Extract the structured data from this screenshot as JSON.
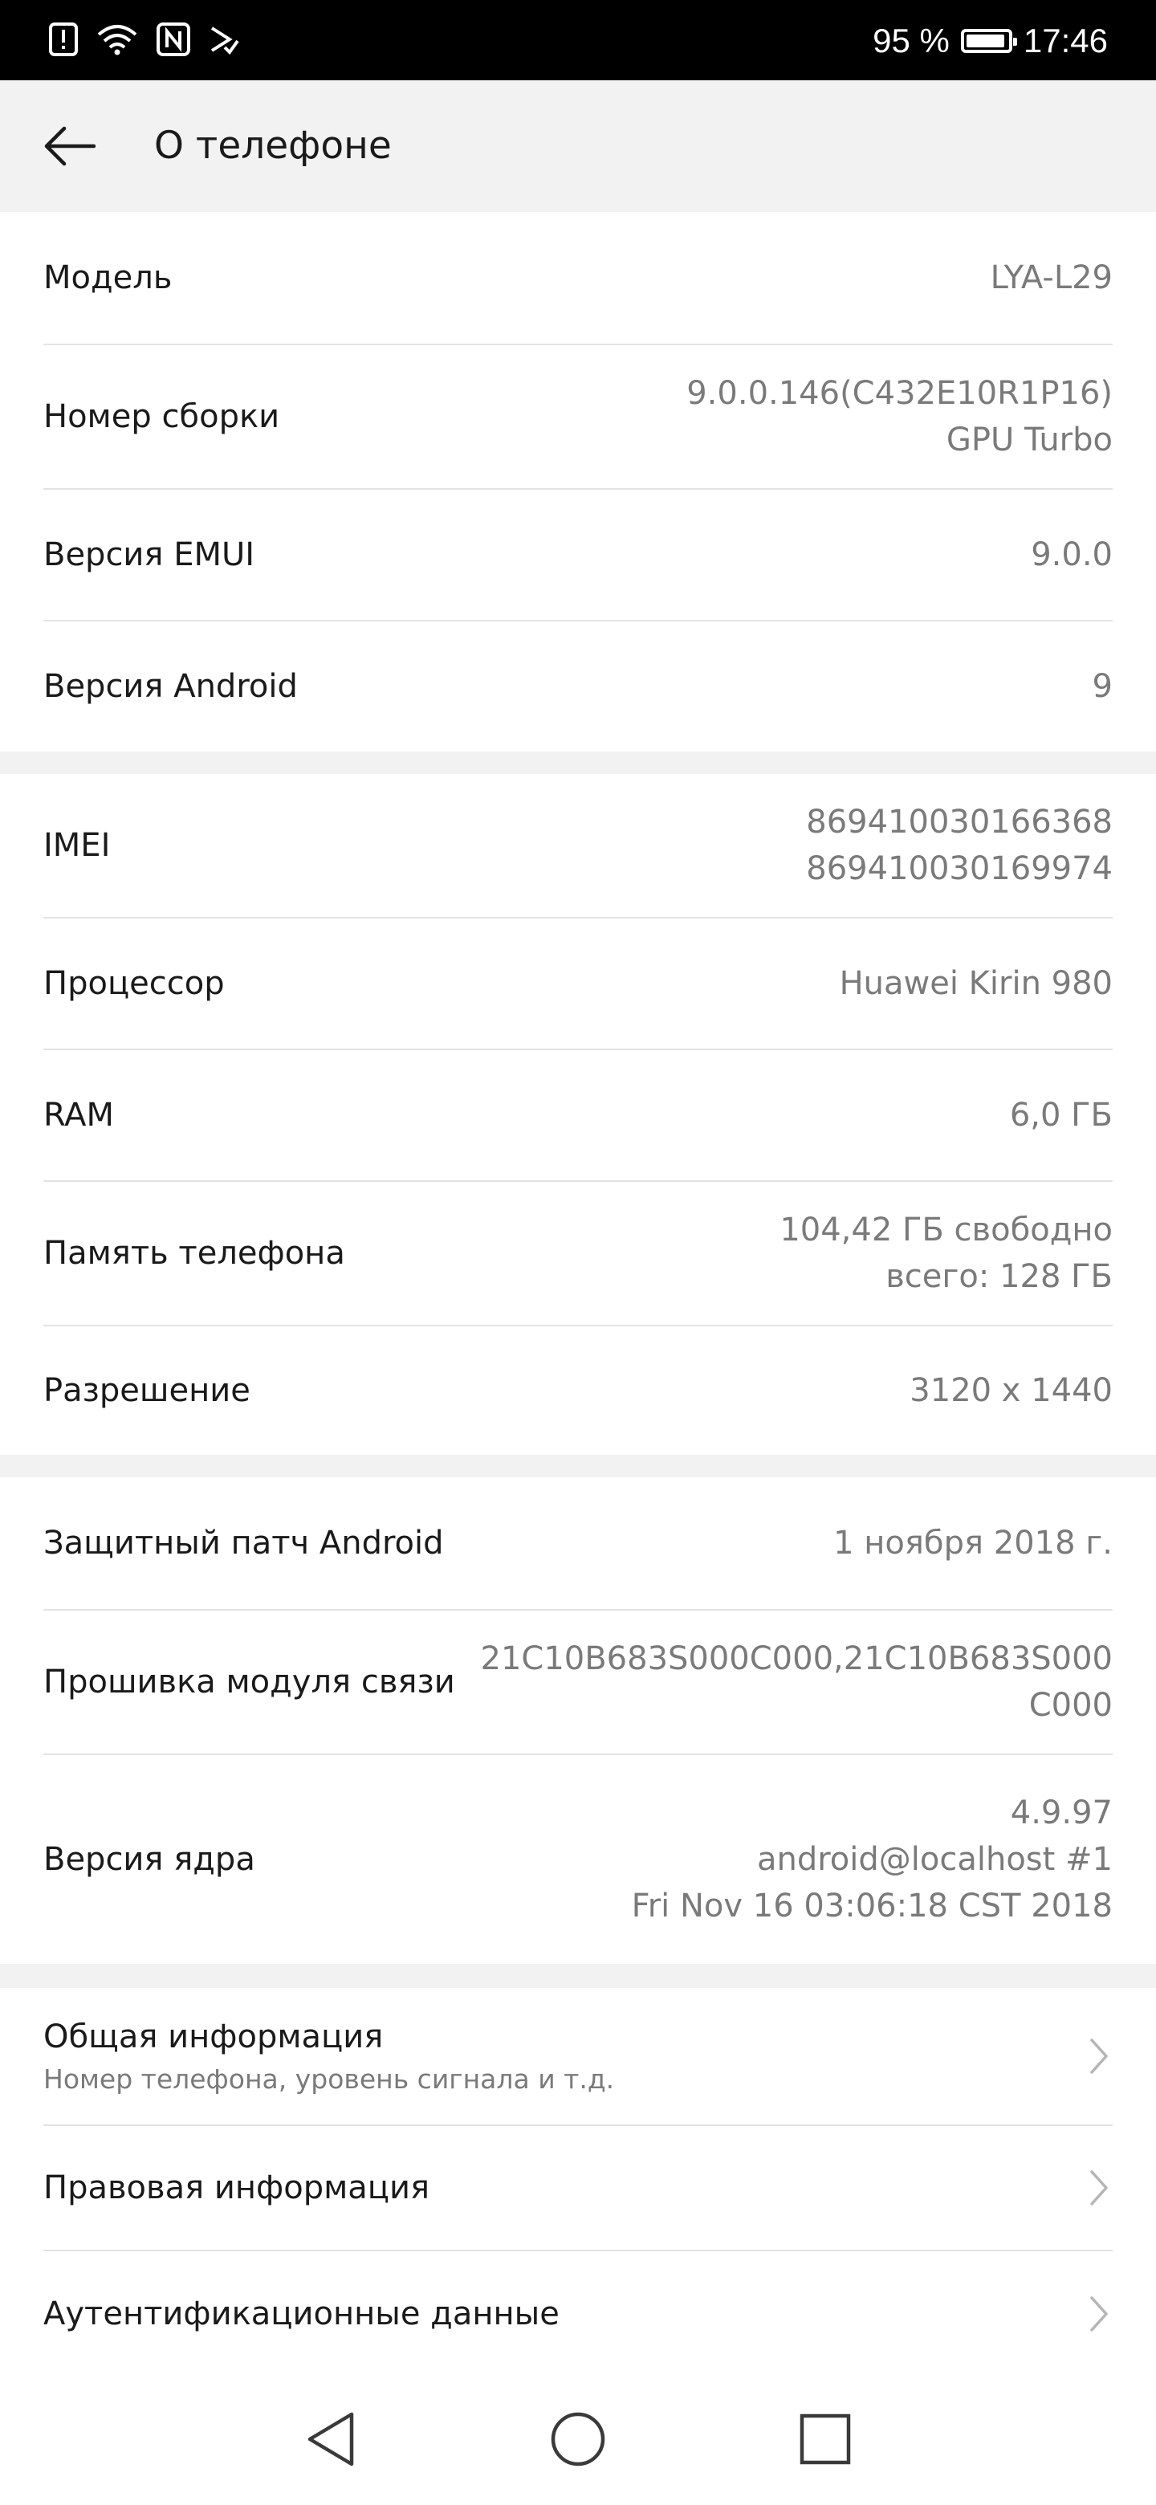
{
  "status_bar": {
    "battery_percent": "95 %",
    "battery_level": 0.95,
    "time": "17:46",
    "icons": [
      "alert-icon",
      "wifi-icon",
      "nfc-icon",
      "data-saver-icon"
    ]
  },
  "header": {
    "title": "О телефоне",
    "back_icon": "arrow-left-icon"
  },
  "sections": {
    "device": [
      {
        "label": "Модель",
        "lines": [
          "LYA-L29"
        ]
      },
      {
        "label": "Номер сборки",
        "lines": [
          "9.0.0.146(C432E10R1P16)",
          "GPU Turbo"
        ]
      },
      {
        "label": "Версия EMUI",
        "lines": [
          "9.0.0"
        ]
      },
      {
        "label": "Версия Android",
        "lines": [
          "9"
        ]
      }
    ],
    "hardware": [
      {
        "label": "IMEI",
        "lines": [
          "869410030166368",
          "869410030169974"
        ]
      },
      {
        "label": "Процессор",
        "lines": [
          "Huawei Kirin 980"
        ]
      },
      {
        "label": "RAM",
        "lines": [
          "6,0  ГБ"
        ]
      },
      {
        "label": "Память телефона",
        "lines": [
          "104,42  ГБ свободно",
          "всего: 128  ГБ"
        ]
      },
      {
        "label": "Разрешение",
        "lines": [
          "3120 x 1440"
        ]
      }
    ],
    "software": [
      {
        "label": "Защитный патч Android",
        "lines": [
          "1 ноября 2018 г."
        ]
      },
      {
        "label": "Прошивка модуля связи",
        "lines": [
          "21C10B683S000C000,21C10B683S000",
          "C000"
        ]
      },
      {
        "label": "Версия ядра",
        "lines": [
          "4.9.97",
          "android@localhost #1",
          "Fri Nov 16 03:06:18 CST 2018"
        ]
      }
    ],
    "links": [
      {
        "label": "Общая информация",
        "sub": "Номер телефона, уровень сигнала и т.д."
      },
      {
        "label": "Правовая информация"
      },
      {
        "label": "Аутентификационные данные"
      }
    ]
  },
  "nav_bar": {
    "icons": [
      "nav-back-icon",
      "nav-home-icon",
      "nav-recents-icon"
    ]
  },
  "colors": {
    "status_bar_bg": "#000000",
    "app_bar_bg": "#f2f2f2",
    "value_text": "#7a7a7a",
    "separator": "#e3e3e3"
  }
}
